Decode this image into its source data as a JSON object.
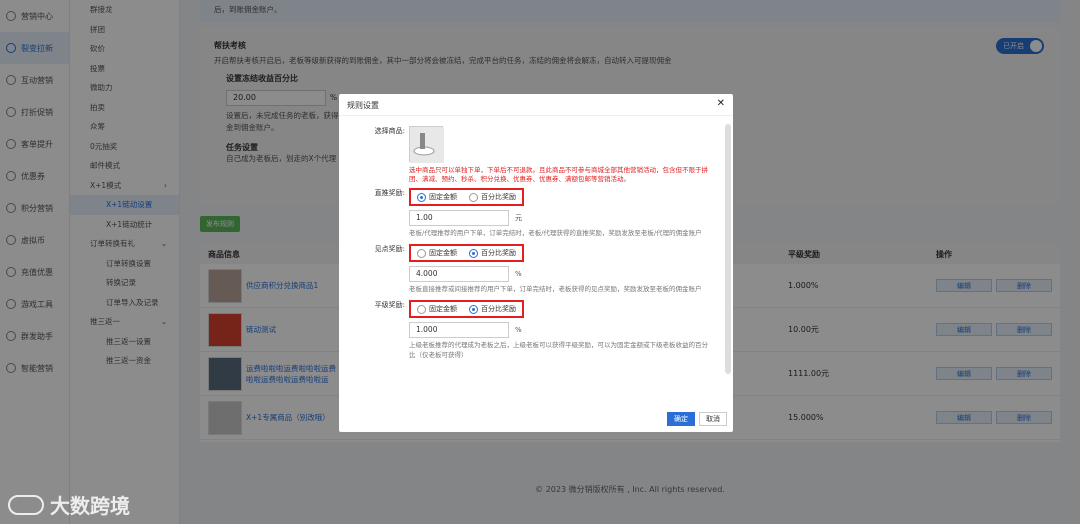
{
  "sidebar": {
    "items": [
      {
        "label": "营销中心",
        "icon": "marketing-icon"
      },
      {
        "label": "裂变拉新",
        "icon": "fission-icon",
        "active": true
      },
      {
        "label": "互动营销",
        "icon": "interact-icon"
      },
      {
        "label": "打折促销",
        "icon": "discount-icon"
      },
      {
        "label": "客单提升",
        "icon": "order-icon"
      },
      {
        "label": "优惠券",
        "icon": "coupon-icon"
      },
      {
        "label": "积分营销",
        "icon": "points-icon"
      },
      {
        "label": "虚拟币",
        "icon": "coin-icon"
      },
      {
        "label": "充值优惠",
        "icon": "recharge-icon"
      },
      {
        "label": "游戏工具",
        "icon": "game-icon"
      },
      {
        "label": "群发助手",
        "icon": "broadcast-icon"
      },
      {
        "label": "智能营销",
        "icon": "smart-icon"
      }
    ]
  },
  "submenu": {
    "items": [
      {
        "label": "群接龙"
      },
      {
        "label": "拼团"
      },
      {
        "label": "砍价"
      },
      {
        "label": "投票"
      },
      {
        "label": "微助力"
      },
      {
        "label": "拍卖"
      },
      {
        "label": "众筹"
      },
      {
        "label": "0元抽奖"
      },
      {
        "label": "邮件模式"
      },
      {
        "label": "X+1模式",
        "arrow": "›"
      },
      {
        "label": "X+1链动设置",
        "child": true,
        "active": true
      },
      {
        "label": "X+1链动统计",
        "child": true
      },
      {
        "label": "订单转换有礼",
        "arrow": "⌄"
      },
      {
        "label": "订单转换设置",
        "child": true
      },
      {
        "label": "转换记录",
        "child": true
      },
      {
        "label": "订单导入及记录",
        "child": true
      },
      {
        "label": "推三返一",
        "arrow": "⌄"
      },
      {
        "label": "推三返一设置",
        "child": true
      },
      {
        "label": "推三返一资金",
        "child": true
      }
    ]
  },
  "notice": {
    "text": "后，到账佣金账户。"
  },
  "assist": {
    "title": "帮扶考核",
    "toggle": "已开启",
    "desc": "开启帮扶考核开启后，老板等级新获得的到账佣金，其中一部分将会被冻结，完成平台的任务，冻结的佣金将会解冻，自动转入可提现佣金",
    "freeze_label": "设置冻结收益百分比",
    "freeze_value": "20.00",
    "freeze_unit": "%",
    "freeze_hint": "设置后，未完成任务的老板，获得的佣金到佣金账户。",
    "task_title": "任务设置",
    "task_desc": "自己成为老板后，划走的X个代理"
  },
  "publish_btn": "发布规则",
  "table": {
    "headers": {
      "info": "商品信息",
      "reward": "平级奖励",
      "ops": "操作"
    },
    "rows": [
      {
        "name": "供应商积分兑换商品1",
        "reward": "1.000%",
        "edit": "编辑",
        "del": "删除"
      },
      {
        "name": "链动测试",
        "reward": "10.00元",
        "edit": "编辑",
        "del": "删除"
      },
      {
        "name": "运费啦啦啦运费啦啦啦运费啦啦运费啦啦运费啦啦运",
        "reward": "1111.00元",
        "edit": "编辑",
        "del": "删除"
      },
      {
        "name": "X+1专属商品（别改哦）",
        "reward": "15.000%",
        "edit": "编辑",
        "del": "删除"
      }
    ]
  },
  "footer": "© 2023 微分销版权所有 , Inc. All rights reserved.",
  "modal": {
    "title": "规则设置",
    "select_label": "选择商品:",
    "warning": "选中商品只可以单独下单，下单后不可退款。且此商品不可参与商城全部其他营销活动，包含但不限于拼团、满减、预约、秒杀、积分兑换、优惠券、优惠券、满额包邮等营销活动。",
    "direct": {
      "label": "直推奖励:",
      "opt1": "固定金额",
      "opt2": "百分比奖励",
      "selected": 1,
      "value": "1.00",
      "unit": "元",
      "hint": "老板/代理推荐的用户下单，订单完结时，老板/代理获得的直推奖励，奖励发放至老板/代理的佣金账户"
    },
    "indirect": {
      "label": "见点奖励:",
      "opt1": "固定金额",
      "opt2": "百分比奖励",
      "selected": 2,
      "value": "4.000",
      "unit": "%",
      "hint": "老板直接推荐或间接推荐的用户下单，订单完结时，老板获得的见点奖励，奖励发放至老板的佣金账户"
    },
    "peer": {
      "label": "平级奖励:",
      "opt1": "固定金额",
      "opt2": "百分比奖励",
      "selected": 2,
      "value": "1.000",
      "unit": "%",
      "hint": "上级老板推荐的代理成为老板之后，上级老板可以获得平级奖励，可以为固定金额或下级老板收益的百分比（仅老板可获得）"
    },
    "ok": "确定",
    "cancel": "取消"
  },
  "watermark": "大数跨境"
}
